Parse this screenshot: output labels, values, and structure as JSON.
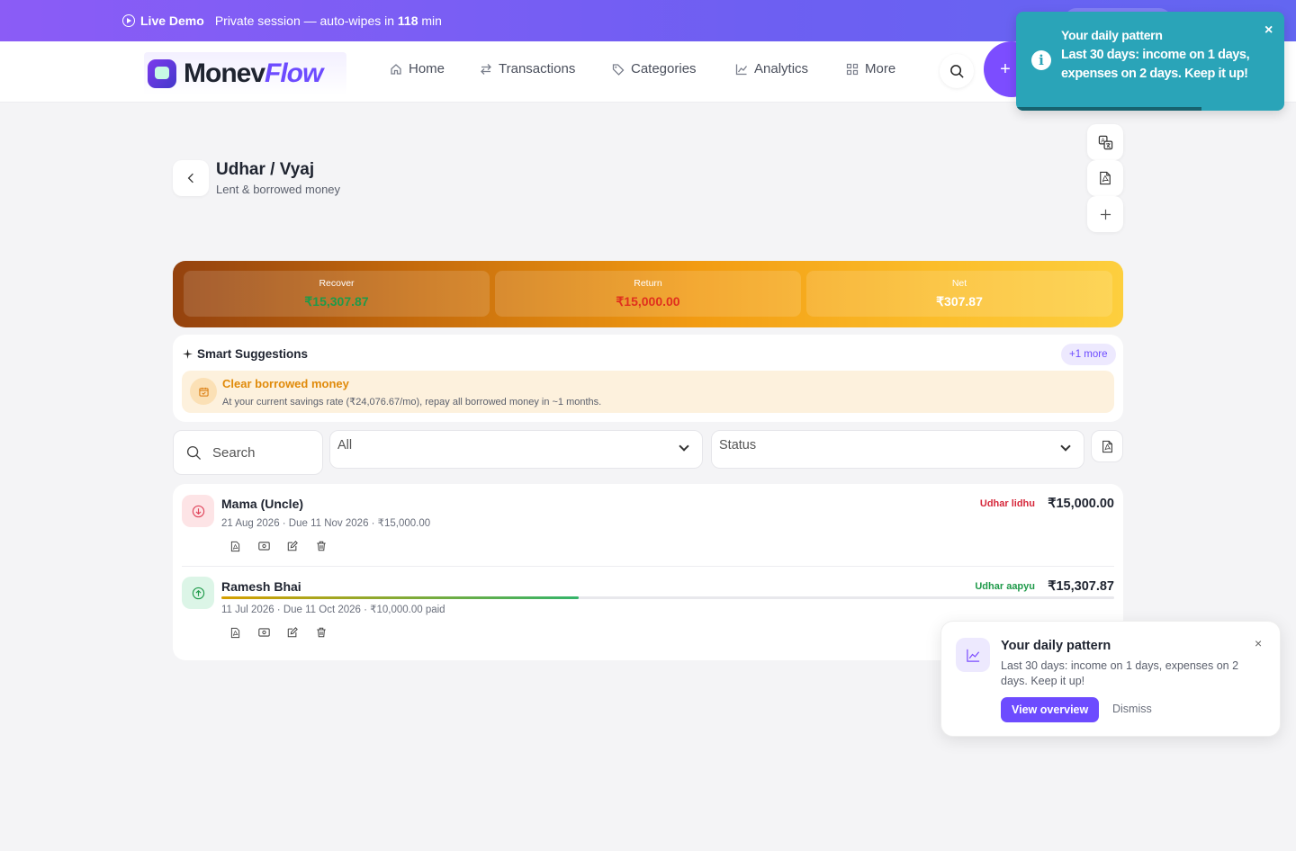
{
  "banner": {
    "live_label": "Live Demo",
    "message_prefix": "Private session — auto-wipes in",
    "minutes": "118",
    "minutes_unit": "min"
  },
  "nav": {
    "logo_part1": "Monev",
    "logo_part2": "Flow",
    "items": [
      {
        "label": "Home",
        "icon": "home-icon"
      },
      {
        "label": "Transactions",
        "icon": "transfer-icon"
      },
      {
        "label": "Categories",
        "icon": "tag-icon"
      },
      {
        "label": "Analytics",
        "icon": "chart-icon"
      },
      {
        "label": "More",
        "icon": "grid-icon"
      }
    ],
    "add_symbol": "+"
  },
  "toast": {
    "title": "Your daily pattern",
    "body": "Last 30 days: income on 1 days, expenses on 2 days. Keep it up!",
    "close": "×",
    "icon": "info-icon"
  },
  "page": {
    "title": "Udhar / Vyaj",
    "subtitle": "Lent & borrowed money"
  },
  "summary": {
    "stats": [
      {
        "label": "Recover",
        "value": "₹15,307.87",
        "color": "#1f9a4a"
      },
      {
        "label": "Return",
        "value": "₹15,000.00",
        "color": "#e0301e"
      },
      {
        "label": "Net",
        "value": "₹307.87",
        "color": "#ffffff"
      }
    ]
  },
  "suggestions": {
    "heading": "Smart Suggestions",
    "more_label": "+1 more",
    "card_title": "Clear borrowed money",
    "card_body": "At your current savings rate (₹24,076.67/mo), repay all borrowed money in ~1 months."
  },
  "filters": {
    "search_placeholder": "Search",
    "type_selected": "All",
    "status_selected": "Status"
  },
  "entries": [
    {
      "name": "Mama (Uncle)",
      "meta": "21 Aug 2026 · Due 11 Nov 2026 · ₹15,000.00",
      "tag": "Udhar lidhu",
      "tag_color": "#d6283b",
      "amount": "₹15,000.00",
      "direction": "down"
    },
    {
      "name": "Ramesh Bhai",
      "meta": "11 Jul 2026 · Due 11 Oct 2026 · ₹10,000.00 paid",
      "tag": "Udhar aapyu",
      "tag_color": "#1f9a4a",
      "amount": "₹15,307.87",
      "direction": "up",
      "progress": 0.4
    }
  ],
  "notification": {
    "title": "Your daily pattern",
    "body": "Last 30 days: income on 1 days, expenses on 2 days. Keep it up!",
    "primary_label": "View overview",
    "dismiss_label": "Dismiss",
    "close": "×"
  }
}
